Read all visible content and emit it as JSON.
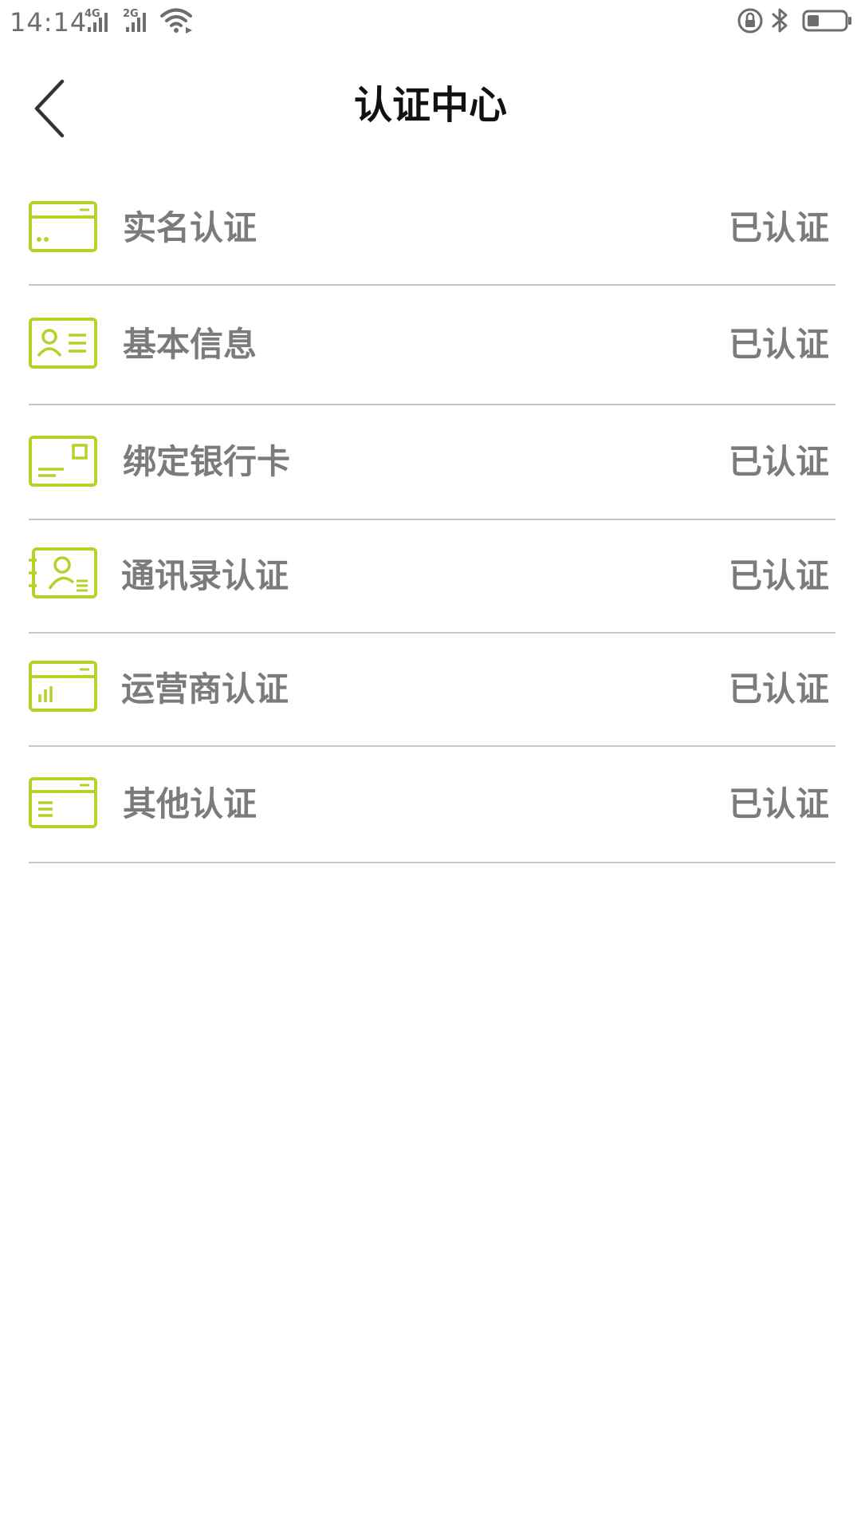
{
  "status_bar": {
    "time": "14:14",
    "network_1": "4G",
    "network_2": "2G",
    "icons": [
      "signal-4g-icon",
      "signal-2g-icon",
      "wifi-icon",
      "rotation-lock-icon",
      "bluetooth-icon",
      "battery-icon"
    ]
  },
  "header": {
    "title": "认证中心",
    "back_icon": "chevron-left-icon"
  },
  "colors": {
    "accent": "#b6d12a",
    "text_gray": "#7b7b7b",
    "divider": "#c8c8c8",
    "title": "#111111"
  },
  "items": [
    {
      "label": "实名认证",
      "status": "已认证",
      "icon": "id-card-icon"
    },
    {
      "label": "基本信息",
      "status": "已认证",
      "icon": "profile-card-icon"
    },
    {
      "label": "绑定银行卡",
      "status": "已认证",
      "icon": "bank-card-icon"
    },
    {
      "label": "通讯录认证",
      "status": "已认证",
      "icon": "contacts-book-icon"
    },
    {
      "label": "运营商认证",
      "status": "已认证",
      "icon": "carrier-chart-icon"
    },
    {
      "label": "其他认证",
      "status": "已认证",
      "icon": "document-icon"
    }
  ]
}
